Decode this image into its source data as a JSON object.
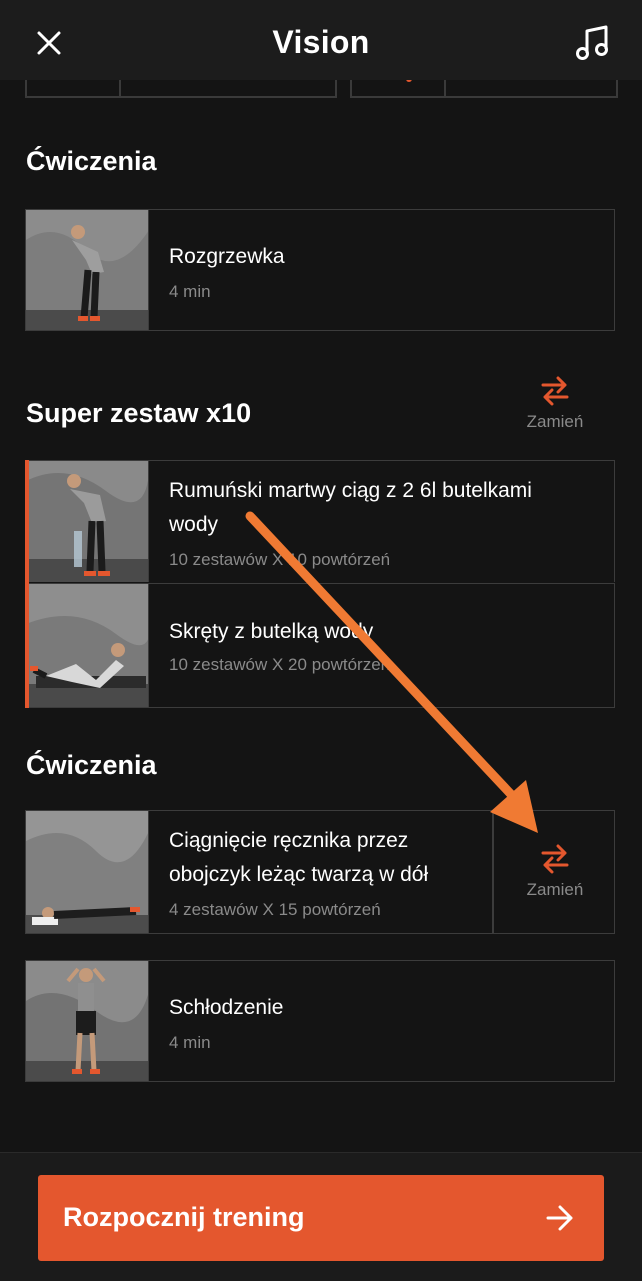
{
  "header": {
    "title": "Vision",
    "close_icon": "close-icon",
    "music_icon": "music-note-icon"
  },
  "sections": {
    "exercises1_title": "Ćwiczenia",
    "superset_title": "Super zestaw x10",
    "exercises2_title": "Ćwiczenia"
  },
  "swap": {
    "label": "Zamień",
    "icon": "swap-arrows-icon"
  },
  "items": [
    {
      "name": "Rozgrzewka",
      "meta": "4 min"
    },
    {
      "name_line1": "Rumuński martwy ciąg z 2 6l butelkami",
      "name_line2": "wody",
      "meta": "10 zestawów X 10 powtórzeń"
    },
    {
      "name": "Skręty z butelką wody",
      "meta": "10 zestawów X 20 powtórzeń"
    },
    {
      "name_line1": "Ciągnięcie ręcznika przez",
      "name_line2": "obojczyk leżąc twarzą w dół",
      "meta": "4 zestawów X 15 powtórzeń"
    },
    {
      "name": "Schłodzenie",
      "meta": "4 min"
    }
  ],
  "footer": {
    "start_label": "Rozpocznij trening",
    "arrow_icon": "arrow-right-icon"
  },
  "colors": {
    "accent": "#e4572e",
    "annotation_arrow": "#f07a33",
    "background": "#141414"
  }
}
